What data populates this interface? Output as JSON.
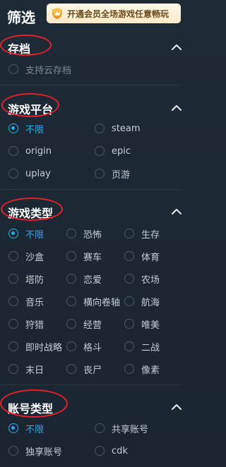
{
  "header": {
    "title": "筛选",
    "vip_banner": "开通会员全场游戏任意畅玩"
  },
  "sections": [
    {
      "title": "存档",
      "options": [
        {
          "label": "支持云存档",
          "selected": false,
          "faded": true
        }
      ]
    },
    {
      "title": "游戏平台",
      "options": [
        {
          "label": "不限",
          "selected": true
        },
        {
          "label": "steam",
          "selected": false
        },
        {
          "label": "origin",
          "selected": false
        },
        {
          "label": "epic",
          "selected": false
        },
        {
          "label": "uplay",
          "selected": false
        },
        {
          "label": "页游",
          "selected": false
        }
      ]
    },
    {
      "title": "游戏类型",
      "options": [
        {
          "label": "不限",
          "selected": true
        },
        {
          "label": "恐怖",
          "selected": false
        },
        {
          "label": "生存",
          "selected": false
        },
        {
          "label": "沙盒",
          "selected": false
        },
        {
          "label": "赛车",
          "selected": false
        },
        {
          "label": "体育",
          "selected": false
        },
        {
          "label": "塔防",
          "selected": false
        },
        {
          "label": "恋爱",
          "selected": false
        },
        {
          "label": "农场",
          "selected": false
        },
        {
          "label": "音乐",
          "selected": false
        },
        {
          "label": "横向卷轴",
          "selected": false
        },
        {
          "label": "航海",
          "selected": false
        },
        {
          "label": "狩猎",
          "selected": false
        },
        {
          "label": "经营",
          "selected": false
        },
        {
          "label": "唯美",
          "selected": false
        },
        {
          "label": "即时战略",
          "selected": false
        },
        {
          "label": "格斗",
          "selected": false
        },
        {
          "label": "二战",
          "selected": false
        },
        {
          "label": "末日",
          "selected": false
        },
        {
          "label": "丧尸",
          "selected": false
        },
        {
          "label": "像素",
          "selected": false
        }
      ]
    },
    {
      "title": "账号类型",
      "options": [
        {
          "label": "不限",
          "selected": true
        },
        {
          "label": "共享账号",
          "selected": false
        },
        {
          "label": "独享账号",
          "selected": false
        },
        {
          "label": "cdk",
          "selected": false
        }
      ]
    }
  ],
  "colors": {
    "accent": "#2ea8e6",
    "highlight_ring": "#e5202a",
    "background": "#1e2a36"
  }
}
